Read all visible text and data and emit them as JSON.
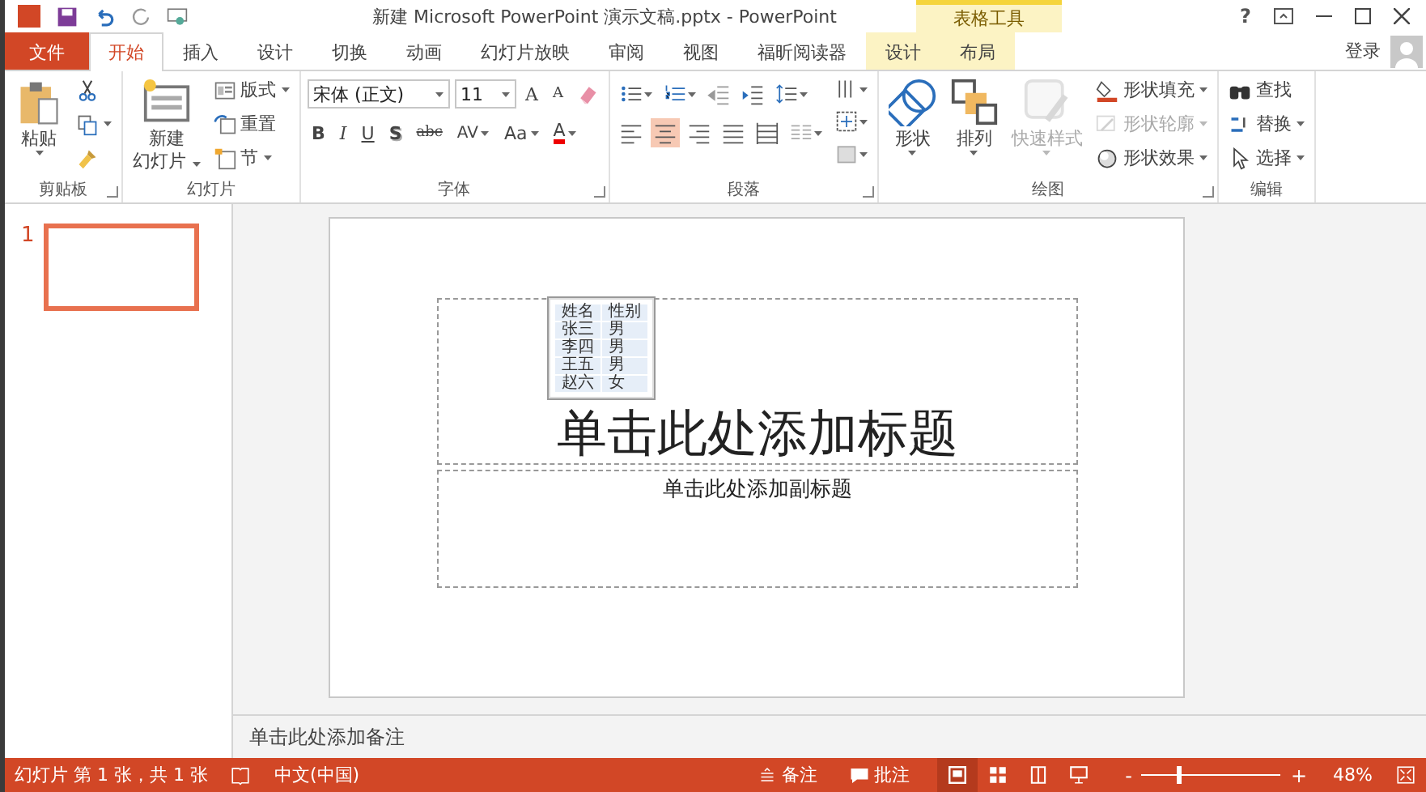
{
  "window": {
    "title": "新建 Microsoft PowerPoint 演示文稿.pptx - PowerPoint",
    "context_tab_group": "表格工具",
    "help": "?",
    "sign_in": "登录"
  },
  "tabs": [
    {
      "label": "文件",
      "kind": "file",
      "selected": false
    },
    {
      "label": "开始",
      "kind": "normal",
      "selected": true
    },
    {
      "label": "插入",
      "kind": "normal",
      "selected": false
    },
    {
      "label": "设计",
      "kind": "normal",
      "selected": false
    },
    {
      "label": "切换",
      "kind": "normal",
      "selected": false
    },
    {
      "label": "动画",
      "kind": "normal",
      "selected": false
    },
    {
      "label": "幻灯片放映",
      "kind": "normal",
      "selected": false
    },
    {
      "label": "审阅",
      "kind": "normal",
      "selected": false
    },
    {
      "label": "视图",
      "kind": "normal",
      "selected": false
    },
    {
      "label": "福昕阅读器",
      "kind": "normal",
      "selected": false
    },
    {
      "label": "设计",
      "kind": "context",
      "selected": false
    },
    {
      "label": "布局",
      "kind": "context",
      "selected": false
    }
  ],
  "ribbon": {
    "groups": [
      {
        "kind": "buttons",
        "label": "剪贴板",
        "launcher": true,
        "items": [
          {
            "kind": "large",
            "label": "粘贴",
            "dropdown": true,
            "disabled": false
          },
          {
            "kind": "small",
            "dropdown": false,
            "disabled": false
          },
          {
            "kind": "small",
            "dropdown": true,
            "disabled": false
          },
          {
            "kind": "small",
            "dropdown": false,
            "disabled": false
          }
        ]
      },
      {
        "kind": "buttons",
        "label": "幻灯片",
        "launcher": false,
        "items": [
          {
            "kind": "large",
            "label": "新建",
            "label2": "幻灯片",
            "dropdown": true,
            "disabled": false
          },
          {
            "kind": "small",
            "label": "版式",
            "dropdown": true,
            "disabled": false
          },
          {
            "kind": "small",
            "label": "重置",
            "dropdown": false,
            "disabled": false
          },
          {
            "kind": "small",
            "label": "节",
            "dropdown": true,
            "disabled": false
          }
        ]
      },
      {
        "kind": "font",
        "label": "字体",
        "launcher": true,
        "font": "宋体 (正文)",
        "size": "11",
        "grow": "A",
        "shrink": "A",
        "format": [
          {
            "label": "B",
            "kind": "bold"
          },
          {
            "label": "I",
            "kind": "italic"
          },
          {
            "label": "U",
            "kind": "underline"
          },
          {
            "label": "S",
            "kind": "shadow"
          },
          {
            "label": "abc",
            "kind": "strike"
          },
          {
            "label": "AV",
            "kind": "spacing"
          },
          {
            "label": "Aa",
            "kind": "case"
          },
          {
            "label": "A",
            "kind": "color"
          }
        ]
      },
      {
        "kind": "paragraph",
        "label": "段落",
        "launcher": true,
        "align": [
          {
            "selected": false
          },
          {
            "selected": true
          },
          {
            "selected": false
          },
          {
            "selected": false
          },
          {
            "selected": false
          }
        ]
      },
      {
        "kind": "buttons",
        "label": "绘图",
        "launcher": true,
        "items": [
          {
            "kind": "large",
            "label": "形状",
            "dropdown": true,
            "disabled": false
          },
          {
            "kind": "large",
            "label": "排列",
            "dropdown": true,
            "disabled": false
          },
          {
            "kind": "large",
            "label": "快速样式",
            "dropdown": true,
            "disabled": true
          },
          {
            "kind": "small",
            "label": "形状填充",
            "dropdown": true,
            "disabled": false
          },
          {
            "kind": "small",
            "label": "形状轮廓",
            "dropdown": true,
            "disabled": true
          },
          {
            "kind": "small",
            "label": "形状效果",
            "dropdown": true,
            "disabled": false
          }
        ]
      },
      {
        "kind": "buttons",
        "label": "编辑",
        "launcher": false,
        "items": [
          {
            "kind": "small",
            "label": "查找",
            "dropdown": false,
            "disabled": false
          },
          {
            "kind": "small",
            "label": "替换",
            "dropdown": true,
            "disabled": false
          },
          {
            "kind": "small",
            "label": "选择",
            "dropdown": true,
            "disabled": false
          }
        ]
      }
    ]
  },
  "thumbnails": [
    {
      "number": "1",
      "selected": true
    }
  ],
  "slide": {
    "title_placeholder": "单击此处添加标题",
    "subtitle_placeholder": "单击此处添加副标题",
    "table": {
      "selected": true,
      "rows": [
        [
          "姓名",
          "性别"
        ],
        [
          "张三",
          "男"
        ],
        [
          "李四",
          "男"
        ],
        [
          "王五",
          "男"
        ],
        [
          "赵六",
          "女"
        ]
      ]
    }
  },
  "notes": {
    "placeholder": "单击此处添加备注"
  },
  "status_bar": {
    "slide_info": "幻灯片 第 1 张，共 1 张",
    "language": "中文(中国)",
    "notes": "备注",
    "comments": "批注",
    "views": [
      {
        "selected": true
      },
      {
        "selected": false
      },
      {
        "selected": false
      },
      {
        "selected": false
      }
    ],
    "zoom": {
      "minus": "-",
      "plus": "+",
      "level": 0.26,
      "reading": "48%"
    }
  }
}
